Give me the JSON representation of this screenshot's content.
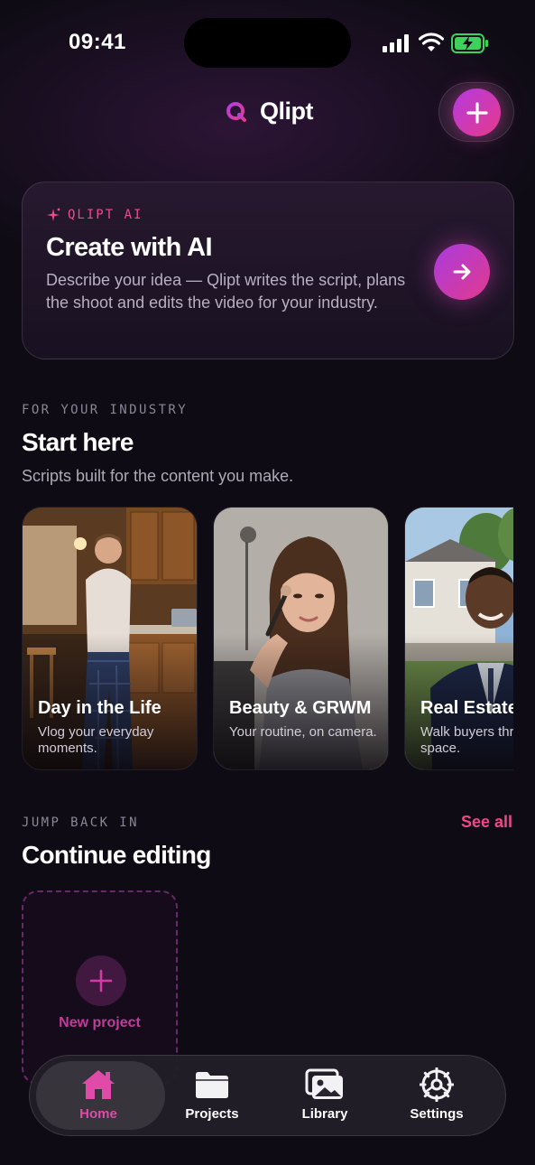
{
  "status_bar": {
    "time": "09:41"
  },
  "header": {
    "brand": "Qlipt"
  },
  "ai_card": {
    "eyebrow": "QLIPT AI",
    "title": "Create with AI",
    "description": "Describe your idea — Qlipt writes the script, plans the shoot and edits the video for your industry."
  },
  "industry": {
    "eyebrow": "FOR YOUR INDUSTRY",
    "title": "Start here",
    "subtitle": "Scripts built for the content you make.",
    "cards": [
      {
        "title": "Day in the Life",
        "description": "Vlog your everyday moments."
      },
      {
        "title": "Beauty & GRWM",
        "description": "Your routine, on camera."
      },
      {
        "title": "Real Estate",
        "description": "Walk buyers through the space."
      }
    ]
  },
  "continue": {
    "eyebrow": "JUMP BACK IN",
    "title": "Continue editing",
    "see_all": "See all",
    "new_project": "New project"
  },
  "tabs": [
    {
      "label": "Home",
      "icon": "home-icon",
      "active": true
    },
    {
      "label": "Projects",
      "icon": "folder-icon",
      "active": false
    },
    {
      "label": "Library",
      "icon": "photo-library-icon",
      "active": false
    },
    {
      "label": "Settings",
      "icon": "gear-icon",
      "active": false
    }
  ],
  "colors": {
    "accent": "#e64a8f",
    "accent_purple": "#a93be0",
    "background": "#0e0b14"
  }
}
